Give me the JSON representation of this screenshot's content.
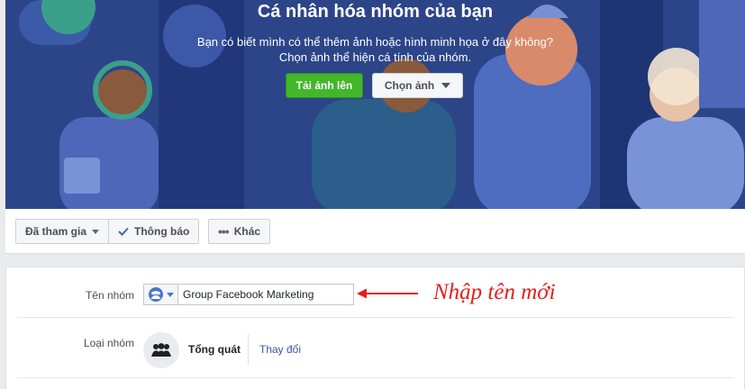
{
  "cover": {
    "title": "Cá nhân hóa nhóm của bạn",
    "description_line1": "Bạn có biết mình có thể thêm ảnh hoặc hình minh họa ở đây không?",
    "description_line2": "Chọn ảnh thể hiện cá tính của nhóm.",
    "upload_label": "Tải ảnh lên",
    "choose_label": "Chọn ảnh"
  },
  "actions": {
    "joined_label": "Đã tham gia",
    "notifications_label": "Thông báo",
    "more_label": "Khác"
  },
  "settings": {
    "name_label": "Tên nhóm",
    "name_value": "Group Facebook Marketing",
    "annotation": "Nhập tên mới",
    "type_label": "Loại nhóm",
    "type_value": "Tổng quát",
    "change_label": "Thay đổi"
  },
  "colors": {
    "cover_bg": "#2f4a8f",
    "upload_green": "#42b72a",
    "link_blue": "#365899",
    "annotation_red": "#e41e1e"
  }
}
